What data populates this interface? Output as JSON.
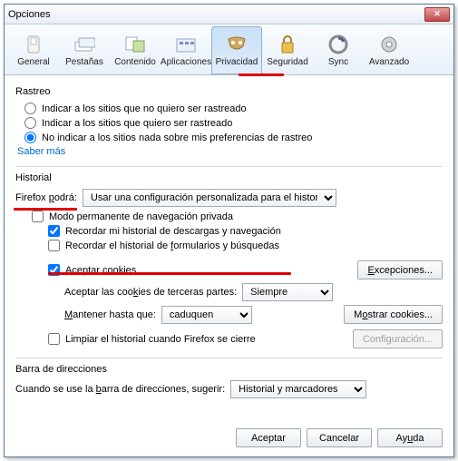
{
  "window": {
    "title": "Opciones"
  },
  "tabs": {
    "general": "General",
    "pestanas": "Pestañas",
    "contenido": "Contenido",
    "aplicaciones": "Aplicaciones",
    "privacidad": "Privacidad",
    "seguridad": "Seguridad",
    "sync": "Sync",
    "avanzado": "Avanzado"
  },
  "tracking": {
    "group_label": "Rastreo",
    "opt1": "Indicar a los sitios que no quiero ser rastreado",
    "opt2": "Indicar a los sitios que quiero ser rastreado",
    "opt3": "No indicar a los sitios nada sobre mis preferencias de rastreo",
    "learn_more": "Saber más"
  },
  "history": {
    "group_label": "Historial",
    "firefox_podra": "Firefox podrá:",
    "mode_selected": "Usar una configuración personalizada para el historial",
    "perm_private": "Modo permanente de navegación privada",
    "remember_dl": "Recordar mi historial de descargas y navegación",
    "remember_forms": "Recordar el historial de formularios y búsquedas",
    "accept_cookies": "Aceptar cookies",
    "exceptions_btn": "Excepciones...",
    "third_party_label": "Aceptar las cookies de terceras partes:",
    "third_party_selected": "Siempre",
    "keep_until_label": "Mantener hasta que:",
    "keep_until_selected": "caduquen",
    "show_cookies_btn": "Mostrar cookies...",
    "clear_on_close": "Limpiar el historial cuando Firefox se cierre",
    "config_btn": "Configuración..."
  },
  "locationbar": {
    "group_label": "Barra de direcciones",
    "suggest_label": "Cuando se use la barra de direcciones, sugerir:",
    "suggest_selected": "Historial y marcadores"
  },
  "buttons": {
    "accept": "Aceptar",
    "cancel": "Cancelar",
    "help": "Ayuda"
  }
}
